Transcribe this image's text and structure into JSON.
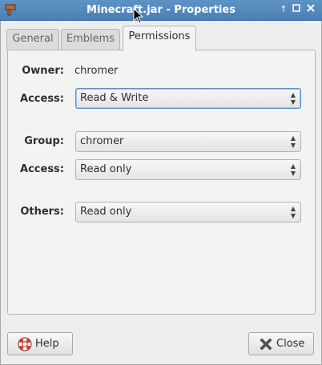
{
  "window": {
    "title": "Minecraft.jar - Properties"
  },
  "tabs": [
    {
      "label": "General"
    },
    {
      "label": "Emblems"
    },
    {
      "label": "Permissions",
      "active": true
    }
  ],
  "permissions": {
    "owner_label": "Owner:",
    "owner_value": "chromer",
    "owner_access_label": "Access:",
    "owner_access_value": "Read & Write",
    "group_label": "Group:",
    "group_value": "chromer",
    "group_access_label": "Access:",
    "group_access_value": "Read only",
    "others_label": "Others:",
    "others_value": "Read only"
  },
  "buttons": {
    "help_label": "Help",
    "close_label": "Close"
  },
  "icons": {
    "app": "app-icon",
    "help": "lifebuoy-icon",
    "close": "close-x-icon",
    "titlebar": [
      "arrow-up-icon",
      "maximize-icon",
      "close-icon"
    ]
  },
  "colors": {
    "titlebar": "#4a7fb5",
    "focus_border": "#5b8fd0",
    "help_icon": "#d9342b"
  }
}
